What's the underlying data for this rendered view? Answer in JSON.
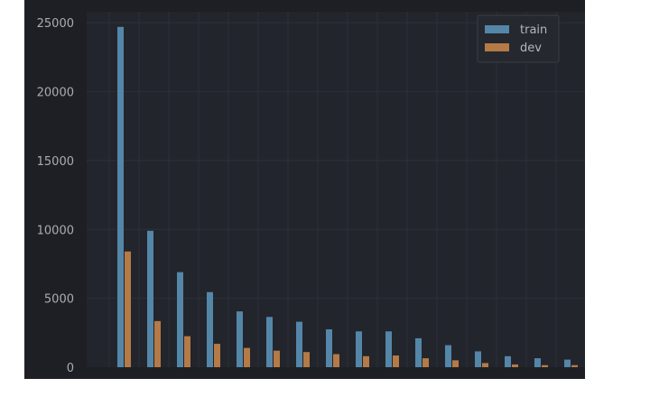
{
  "chart_data": {
    "type": "bar",
    "categories": [
      "",
      "",
      "",
      "",
      "",
      "",
      "",
      "",
      "",
      "",
      "",
      "",
      "",
      "",
      "",
      ""
    ],
    "series": [
      {
        "name": "train",
        "color": "#5486a8",
        "values": [
          24700,
          9900,
          6900,
          5450,
          4050,
          3650,
          3300,
          2750,
          2600,
          2600,
          2100,
          1600,
          1150,
          800,
          650,
          550
        ]
      },
      {
        "name": "dev",
        "color": "#b57a45",
        "values": [
          8400,
          3350,
          2250,
          1700,
          1400,
          1200,
          1100,
          950,
          800,
          850,
          650,
          500,
          300,
          200,
          150,
          150
        ]
      }
    ],
    "yticks": [
      "0",
      "5000",
      "10000",
      "15000",
      "20000",
      "25000"
    ],
    "ylim": [
      0,
      25800
    ],
    "grid": true,
    "legend_position": "top-right",
    "colors": {
      "figure_background": "#1e1f24",
      "axes_background": "#22252c",
      "grid": "#2c3038",
      "tick_text": "#a9acb3",
      "legend_text": "#b4b7bd"
    }
  }
}
